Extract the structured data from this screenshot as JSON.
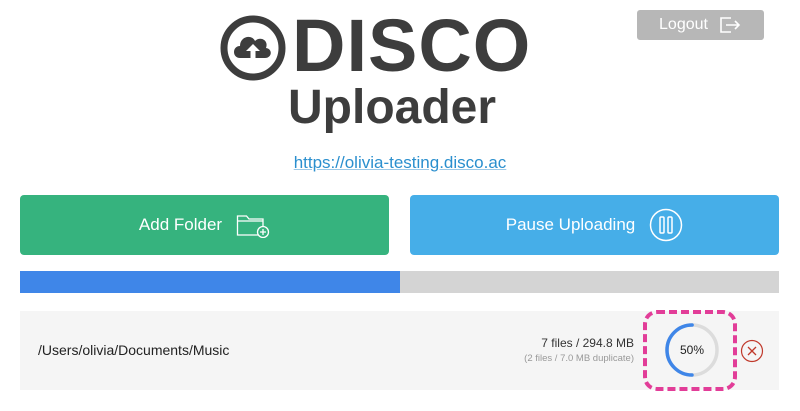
{
  "header": {
    "title": "DISCO",
    "subtitle": "Uploader",
    "logout_label": "Logout"
  },
  "site": {
    "url": "https://olivia-testing.disco.ac"
  },
  "actions": {
    "add_folder_label": "Add Folder",
    "pause_label": "Pause Uploading"
  },
  "overall_progress": {
    "percent": 50
  },
  "uploads": [
    {
      "path": "/Users/olivia/Documents/Music",
      "files_summary": "7 files / 294.8 MB",
      "duplicate_summary": "(2 files / 7.0 MB duplicate)",
      "progress_label": "50%",
      "progress_percent": 50
    }
  ],
  "colors": {
    "brand_text": "#3d3d3d",
    "add_folder": "#36b37e",
    "pause": "#46aee8",
    "progress_fill": "#3f86e8",
    "progress_track": "#d4d4d4",
    "link": "#2a8fce",
    "highlight": "#e23d98",
    "cancel": "#c0392b",
    "logout": "#b7b7b7"
  },
  "icons": {
    "logo": "cloud-upload-icon",
    "logout": "logout-icon",
    "add_folder": "folder-add-icon",
    "pause": "pause-circle-icon",
    "cancel": "close-circle-icon"
  }
}
